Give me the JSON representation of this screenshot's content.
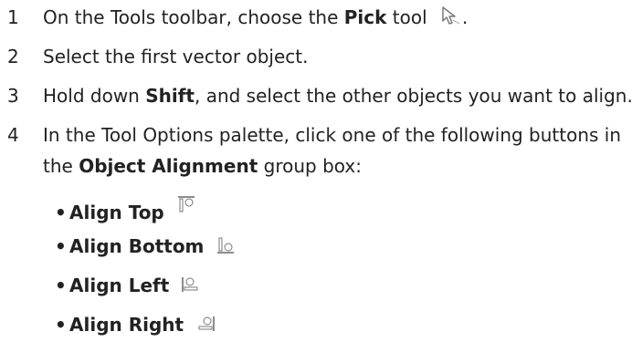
{
  "steps": [
    {
      "number": "1",
      "before": "On the Tools toolbar, choose the ",
      "bold": "Pick",
      "after": " tool",
      "end": ".",
      "icon": "pick-tool-icon"
    },
    {
      "number": "2",
      "text": "Select the first vector object."
    },
    {
      "number": "3",
      "before": "Hold down ",
      "bold": "Shift",
      "after": ", and select the other objects you want to align."
    },
    {
      "number": "4",
      "line1": "In the Tool Options palette, click one of the following buttons in",
      "line2_before": "the ",
      "line2_bold": "Object Alignment",
      "line2_after": " group box:"
    }
  ],
  "options": [
    {
      "bullet": "•",
      "label": "Align Top",
      "icon": "align-top-icon"
    },
    {
      "bullet": "•",
      "label": "Align Bottom",
      "icon": "align-bottom-icon"
    },
    {
      "bullet": "•",
      "label": "Align Left",
      "icon": "align-left-icon"
    },
    {
      "bullet": "•",
      "label": "Align Right",
      "icon": "align-right-icon"
    }
  ]
}
